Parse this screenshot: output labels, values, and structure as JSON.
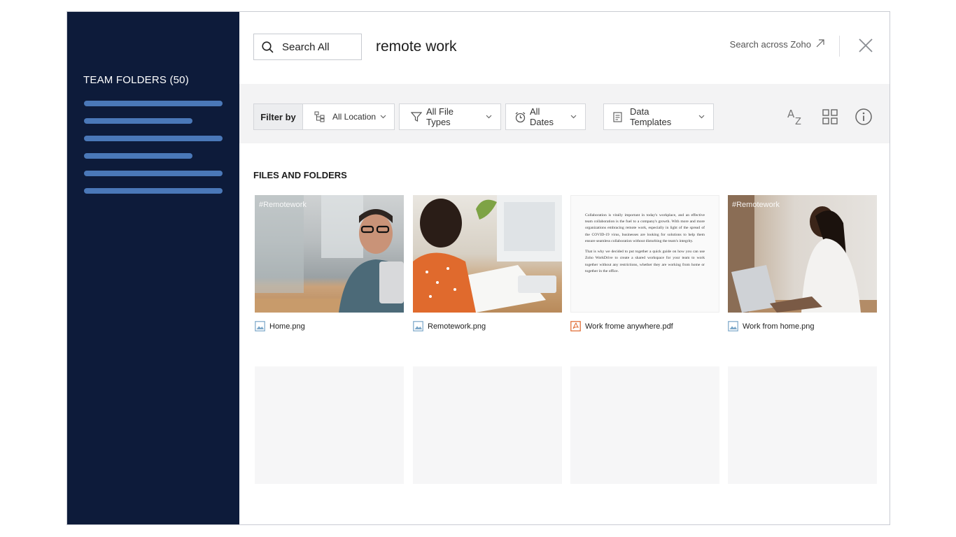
{
  "sidebar": {
    "title": "TEAM FOLDERS (50)",
    "colors": {
      "background": "#0d1b3a",
      "line": "#4a78b8"
    }
  },
  "header": {
    "search_scope": "Search All",
    "query": "remote work",
    "search_across": "Search across Zoho"
  },
  "filters": {
    "filter_by": "Filter by",
    "location": "All Location",
    "file_types": "All File Types",
    "dates": "All Dates",
    "templates": "Data Templates"
  },
  "section_title": "FILES AND FOLDERS",
  "files": [
    {
      "name": "Home.png",
      "tag": "#Remotework",
      "icon": "image-file-icon"
    },
    {
      "name": "Remotework.png",
      "tag": "",
      "icon": "image-file-icon"
    },
    {
      "name": "Work frome anywhere.pdf",
      "tag": "",
      "icon": "pdf-file-icon"
    },
    {
      "name": "Work from home.png",
      "tag": "#Remotework",
      "icon": "image-file-icon"
    }
  ],
  "document_preview": {
    "paragraph_1": "Collaboration is vitally important in today's workplace, and an effective team collaboration is the fuel to a company's growth. With more and more organizations embracing remote work, especially in light of the spread of the COVID-19 virus, businesses are looking for solutions to help them ensure seamless collaboration without disturbing the team's integrity.",
    "paragraph_2": "That is why we decided to put together a quick guide on how you can use Zoho WorkDrive to create a shared workspace for your team to work together without any restrictions, whether they are working from home or together in the office."
  },
  "accent_colors": {
    "pdf": "#e0652a",
    "image": "#7aa6c8"
  }
}
